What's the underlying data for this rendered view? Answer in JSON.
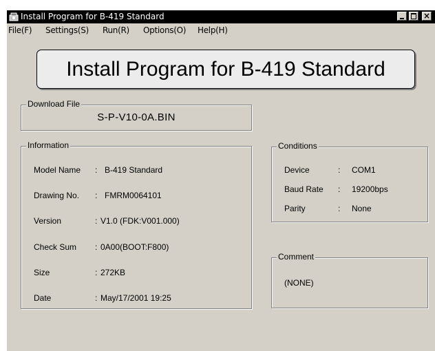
{
  "window": {
    "title": "Install Program for B-419 Standard"
  },
  "menu": [
    {
      "label": "File(F)"
    },
    {
      "label": "Settings(S)"
    },
    {
      "label": "Run(R)"
    },
    {
      "label": "Options(O)"
    },
    {
      "label": "Help(H)"
    }
  ],
  "header": {
    "text": "Install Program for B-419 Standard"
  },
  "download": {
    "legend": "Download File",
    "value": "S-P-V10-0A.BIN"
  },
  "information": {
    "legend": "Information",
    "rows": [
      {
        "label": "Model Name",
        "sep": ":",
        "value": "B-419 Standard"
      },
      {
        "label": "Drawing No.",
        "sep": ":",
        "value": "FMRM0064101"
      },
      {
        "label": "Version",
        "sep": ":",
        "value": "V1.0  (FDK:V001.000)"
      },
      {
        "label": "Check Sum",
        "sep": ":",
        "value": "0A00(BOOT:F800)"
      },
      {
        "label": "Size",
        "sep": ":",
        "value": "272KB"
      },
      {
        "label": "Date",
        "sep": ":",
        "value": "May/17/2001 19:25"
      }
    ]
  },
  "conditions": {
    "legend": "Conditions",
    "rows": [
      {
        "label": "Device",
        "sep": ":",
        "value": "COM1"
      },
      {
        "label": "Baud Rate",
        "sep": ":",
        "value": "19200bps"
      },
      {
        "label": "Parity",
        "sep": ":",
        "value": "None"
      }
    ]
  },
  "comment": {
    "legend": "Comment",
    "text": "(NONE)"
  },
  "colors": {
    "face": "#d4d0c8",
    "titlebar": "#000000",
    "header_bg": "#ececec"
  }
}
